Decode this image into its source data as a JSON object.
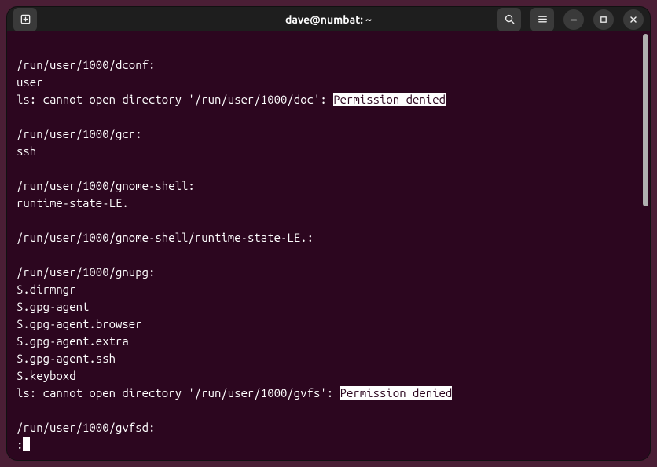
{
  "titlebar": {
    "title": "dave@numbat: ~"
  },
  "terminal": {
    "lines": [
      {
        "segments": [
          {
            "text": ""
          }
        ]
      },
      {
        "segments": [
          {
            "text": "/run/user/1000/dconf:"
          }
        ]
      },
      {
        "segments": [
          {
            "text": "user"
          }
        ]
      },
      {
        "segments": [
          {
            "text": "ls: cannot open directory '/run/user/1000/doc': "
          },
          {
            "text": "Permission denied",
            "highlight": true
          }
        ]
      },
      {
        "segments": [
          {
            "text": ""
          }
        ]
      },
      {
        "segments": [
          {
            "text": "/run/user/1000/gcr:"
          }
        ]
      },
      {
        "segments": [
          {
            "text": "ssh"
          }
        ]
      },
      {
        "segments": [
          {
            "text": ""
          }
        ]
      },
      {
        "segments": [
          {
            "text": "/run/user/1000/gnome-shell:"
          }
        ]
      },
      {
        "segments": [
          {
            "text": "runtime-state-LE."
          }
        ]
      },
      {
        "segments": [
          {
            "text": ""
          }
        ]
      },
      {
        "segments": [
          {
            "text": "/run/user/1000/gnome-shell/runtime-state-LE.:"
          }
        ]
      },
      {
        "segments": [
          {
            "text": ""
          }
        ]
      },
      {
        "segments": [
          {
            "text": "/run/user/1000/gnupg:"
          }
        ]
      },
      {
        "segments": [
          {
            "text": "S.dirmngr"
          }
        ]
      },
      {
        "segments": [
          {
            "text": "S.gpg-agent"
          }
        ]
      },
      {
        "segments": [
          {
            "text": "S.gpg-agent.browser"
          }
        ]
      },
      {
        "segments": [
          {
            "text": "S.gpg-agent.extra"
          }
        ]
      },
      {
        "segments": [
          {
            "text": "S.gpg-agent.ssh"
          }
        ]
      },
      {
        "segments": [
          {
            "text": "S.keyboxd"
          }
        ]
      },
      {
        "segments": [
          {
            "text": "ls: cannot open directory '/run/user/1000/gvfs': "
          },
          {
            "text": "Permission denied",
            "highlight": true
          }
        ]
      },
      {
        "segments": [
          {
            "text": ""
          }
        ]
      },
      {
        "segments": [
          {
            "text": "/run/user/1000/gvfsd:"
          }
        ]
      },
      {
        "segments": [
          {
            "text": ":"
          }
        ],
        "cursor": true
      }
    ]
  }
}
